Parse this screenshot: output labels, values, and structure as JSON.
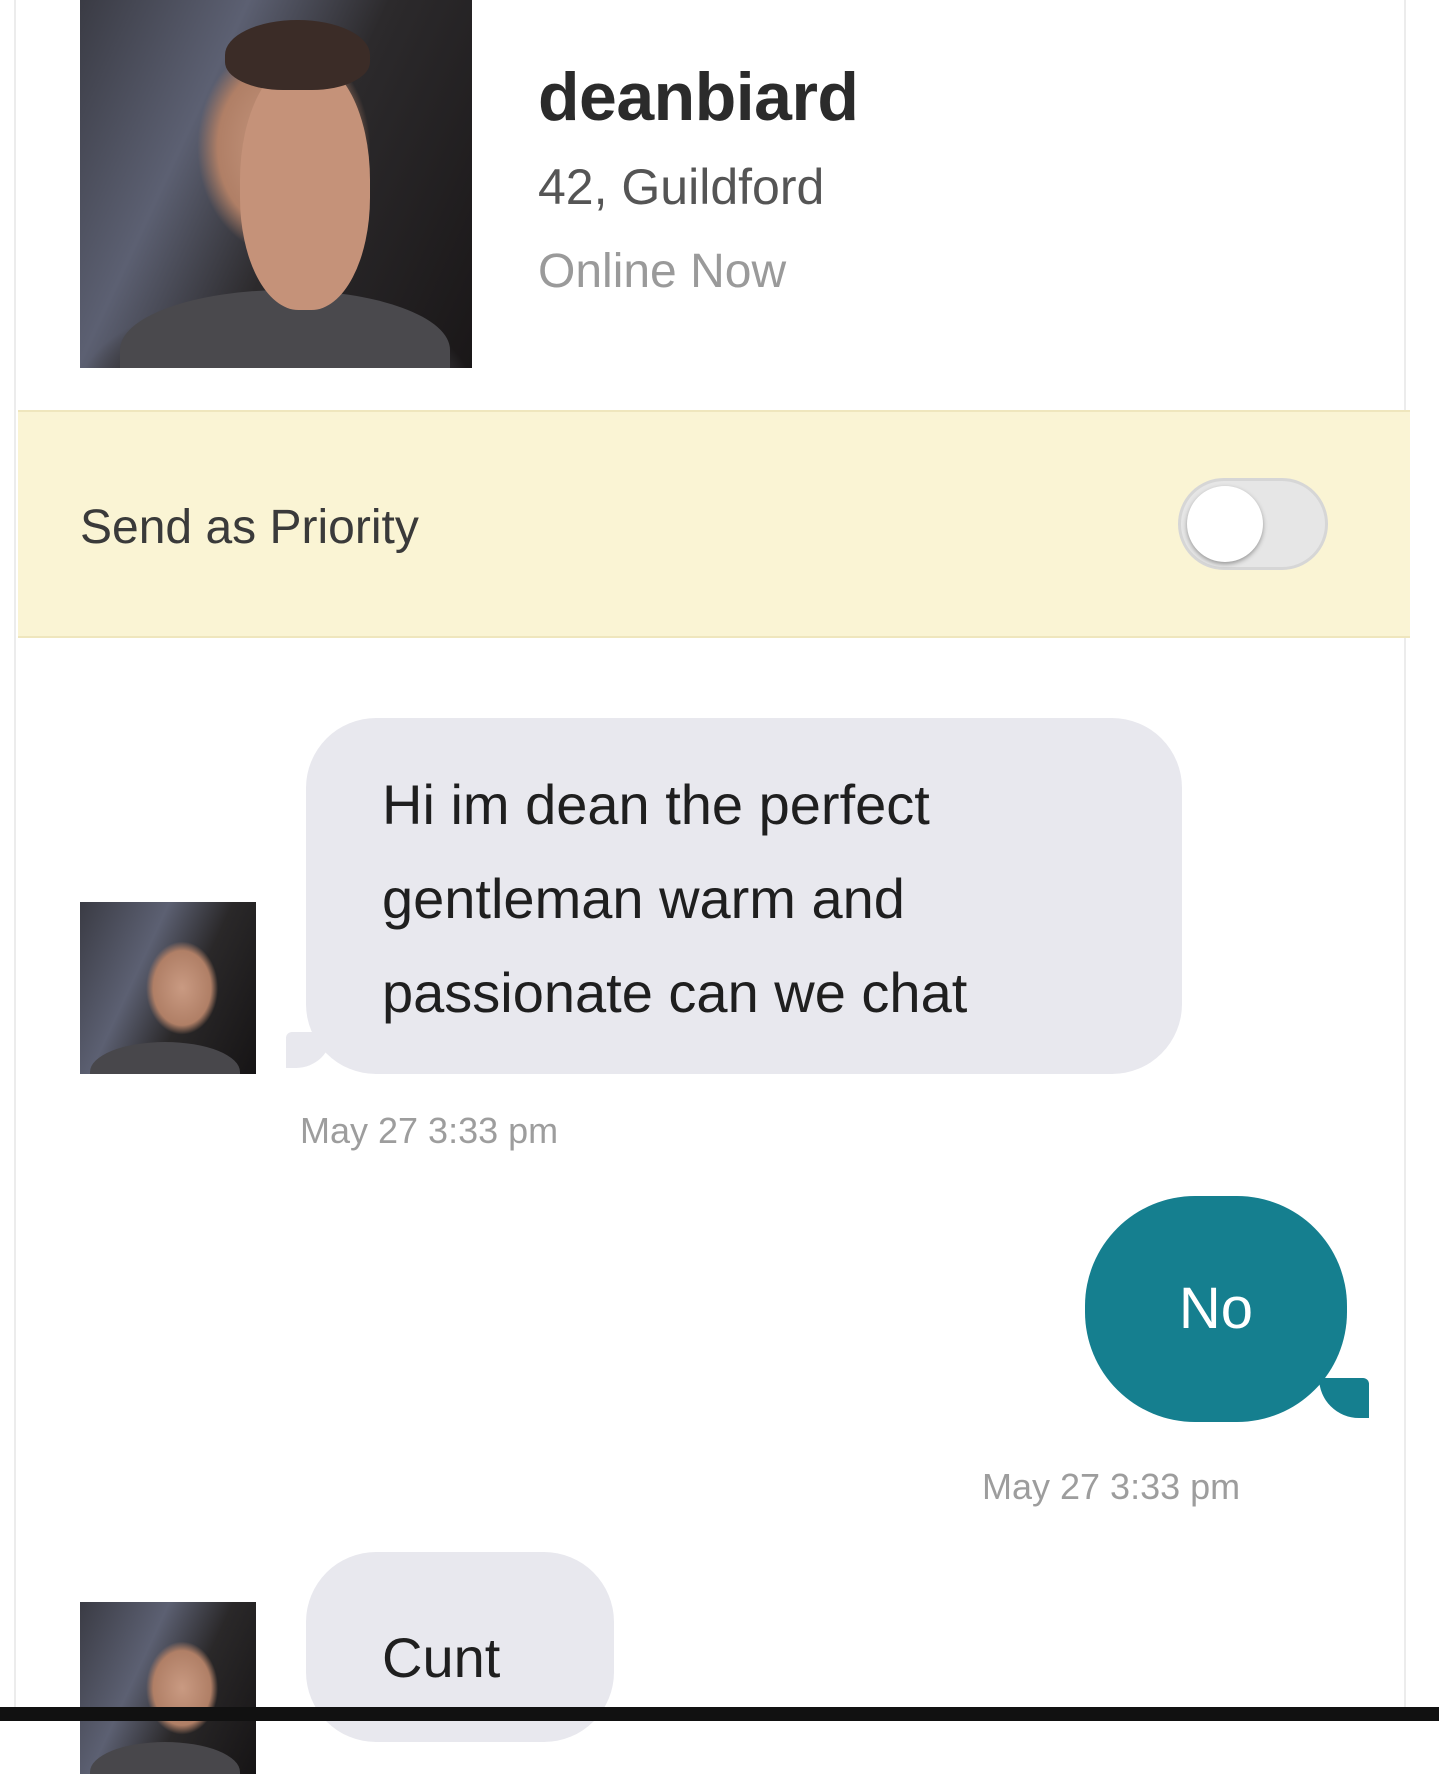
{
  "profile": {
    "username": "deanbiard",
    "age_location": "42, Guildford",
    "status": "Online Now"
  },
  "priority": {
    "label": "Send as Priority",
    "toggle_on": false
  },
  "messages": [
    {
      "direction": "incoming",
      "lines": [
        "Hi im dean the perfect",
        "gentleman warm and",
        "passionate can we chat"
      ],
      "timestamp": "May 27 3:33 pm"
    },
    {
      "direction": "outgoing",
      "lines": [
        "No"
      ],
      "timestamp": "May 27 3:33 pm"
    },
    {
      "direction": "incoming",
      "lines": [
        "Cunt"
      ],
      "timestamp": ""
    }
  ],
  "colors": {
    "outgoing_bubble": "#157f8f",
    "incoming_bubble": "#e8e8ee",
    "priority_bar": "#faf4d4"
  }
}
